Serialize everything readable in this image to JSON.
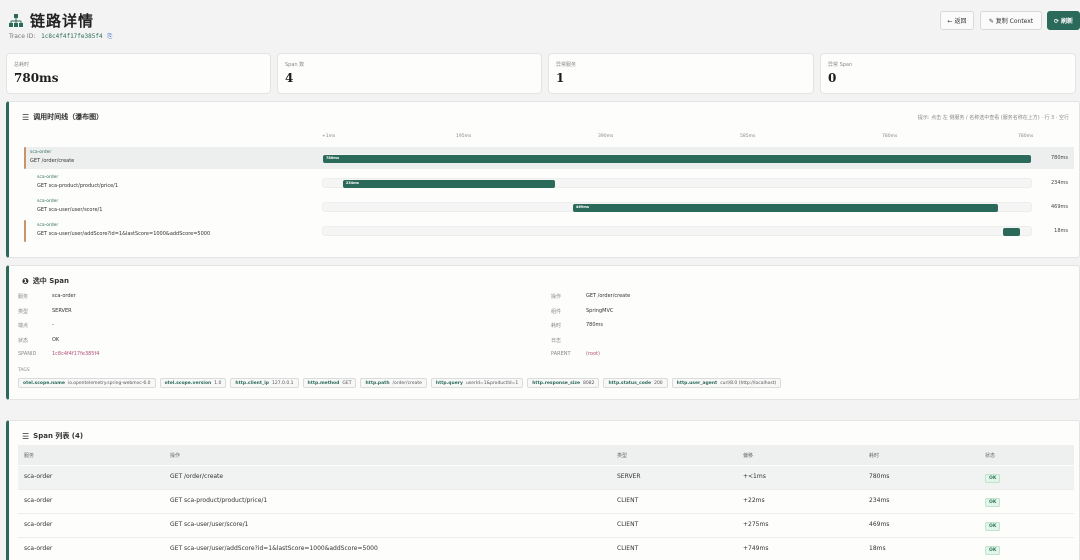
{
  "header": {
    "title": "链路详情",
    "trace_label": "Trace ID:",
    "trace_id": "1c8c4f4f17fe385f4",
    "copy_icon": "copy-icon",
    "buttons": {
      "back": "← 返回",
      "copy_context": "✎ 复制 Context",
      "refresh": "⟳ 刷新"
    }
  },
  "stats": [
    {
      "label": "总耗时",
      "value": "780ms"
    },
    {
      "label": "Span 数",
      "value": "4"
    },
    {
      "label": "异常服务",
      "value": "1"
    },
    {
      "label": "异常 Span",
      "value": "0"
    }
  ],
  "timeline": {
    "title": "调用时间线（瀑布图）",
    "note": "提示: 点击 左 侧服务 / 名称选中查看 (服务名称在上方) · 行 3 · 空行",
    "ticks": [
      "+1ms",
      "195ms",
      "390ms",
      "585ms",
      "780ms",
      "780ms"
    ],
    "rows": [
      {
        "service": "sca-order",
        "operation": "GET /order/create",
        "start_pct": 0,
        "width_pct": 100,
        "bar_label": "780ms",
        "duration": "780ms",
        "selected": true,
        "accent": true
      },
      {
        "service": "sca-order",
        "operation": "GET sca-product/product/price/1",
        "start_pct": 2.8,
        "width_pct": 30,
        "bar_label": "234ms",
        "duration": "234ms",
        "selected": false,
        "accent": false
      },
      {
        "service": "sca-order",
        "operation": "GET sca-user/user/score/1",
        "start_pct": 35.3,
        "width_pct": 60.1,
        "bar_label": "469ms",
        "duration": "469ms",
        "selected": false,
        "accent": false
      },
      {
        "service": "sca-order",
        "operation": "GET sca-user/user/addScore?id=1&lastScore=1000&addScore=5000",
        "start_pct": 96.1,
        "width_pct": 2.3,
        "bar_label": "",
        "duration": "18ms",
        "selected": false,
        "accent": true
      }
    ]
  },
  "span_detail": {
    "title": "选中 Span",
    "left": [
      {
        "label": "服务",
        "value": "sca-order"
      },
      {
        "label": "类型",
        "value": "SERVER"
      },
      {
        "label": "端点",
        "value": "-"
      },
      {
        "label": "状态",
        "value": "OK"
      },
      {
        "label": "SPANID",
        "value": "1c8c4f4f17fe385f4"
      }
    ],
    "right": [
      {
        "label": "操作",
        "value": "GET /order/create"
      },
      {
        "label": "组件",
        "value": "SpringMVC"
      },
      {
        "label": "耗时",
        "value": "780ms"
      },
      {
        "label": "日志",
        "value": ""
      },
      {
        "label": "PARENT",
        "value": "(root)"
      }
    ],
    "tags_label": "TAGS",
    "tags": [
      {
        "k": "otel.scope.name",
        "v": "io.opentelemetry.spring-webmvc-6.0"
      },
      {
        "k": "otel.scope.version",
        "v": "1.0"
      },
      {
        "k": "http.client_ip",
        "v": "127.0.0.1"
      },
      {
        "k": "http.method",
        "v": "GET"
      },
      {
        "k": "http.path",
        "v": "/order/create"
      },
      {
        "k": "http.query",
        "v": "userId=1&productId=1"
      },
      {
        "k": "http.response_size",
        "v": "8082"
      },
      {
        "k": "http.status_code",
        "v": "200"
      },
      {
        "k": "http.user_agent",
        "v": "curl/8.0 (http://localhost)"
      }
    ]
  },
  "span_list": {
    "title": "Span 列表 (4)",
    "headers": [
      "服务",
      "操作",
      "类型",
      "偏移",
      "耗时",
      "状态"
    ],
    "rows": [
      {
        "service": "sca-order",
        "operation": "GET /order/create",
        "kind": "SERVER",
        "offset": "+<1ms",
        "duration": "780ms",
        "status": "OK"
      },
      {
        "service": "sca-order",
        "operation": "GET sca-product/product/price/1",
        "kind": "CLIENT",
        "offset": "+22ms",
        "duration": "234ms",
        "status": "OK"
      },
      {
        "service": "sca-order",
        "operation": "GET sca-user/user/score/1",
        "kind": "CLIENT",
        "offset": "+275ms",
        "duration": "469ms",
        "status": "OK"
      },
      {
        "service": "sca-order",
        "operation": "GET sca-user/user/addScore?id=1&lastScore=1000&addScore=5000",
        "kind": "CLIENT",
        "offset": "+749ms",
        "duration": "18ms",
        "status": "OK"
      }
    ]
  },
  "colors": {
    "accent": "#2b6a5a",
    "highlight": "#c8956a",
    "ok_badge": "#2b7a4e"
  }
}
